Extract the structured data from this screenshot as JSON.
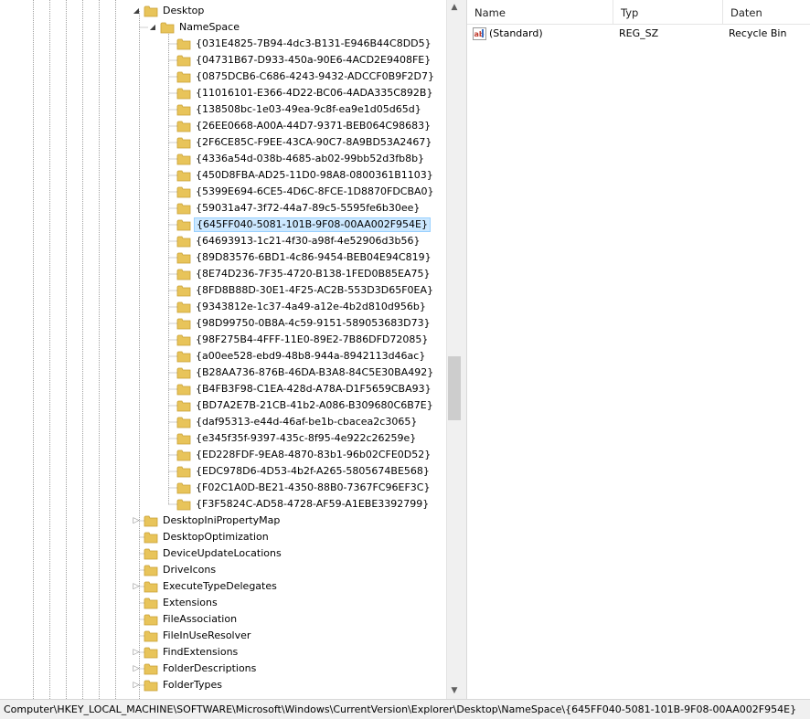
{
  "tree": {
    "expanded_parent": {
      "label": "Desktop"
    },
    "namespace": {
      "label": "NameSpace"
    },
    "namespace_children": [
      {
        "label": "{031E4825-7B94-4dc3-B131-E946B44C8DD5}",
        "selected": false
      },
      {
        "label": "{04731B67-D933-450a-90E6-4ACD2E9408FE}",
        "selected": false
      },
      {
        "label": "{0875DCB6-C686-4243-9432-ADCCF0B9F2D7}",
        "selected": false
      },
      {
        "label": "{11016101-E366-4D22-BC06-4ADA335C892B}",
        "selected": false
      },
      {
        "label": "{138508bc-1e03-49ea-9c8f-ea9e1d05d65d}",
        "selected": false
      },
      {
        "label": "{26EE0668-A00A-44D7-9371-BEB064C98683}",
        "selected": false
      },
      {
        "label": "{2F6CE85C-F9EE-43CA-90C7-8A9BD53A2467}",
        "selected": false
      },
      {
        "label": "{4336a54d-038b-4685-ab02-99bb52d3fb8b}",
        "selected": false
      },
      {
        "label": "{450D8FBA-AD25-11D0-98A8-0800361B1103}",
        "selected": false
      },
      {
        "label": "{5399E694-6CE5-4D6C-8FCE-1D8870FDCBA0}",
        "selected": false
      },
      {
        "label": "{59031a47-3f72-44a7-89c5-5595fe6b30ee}",
        "selected": false
      },
      {
        "label": "{645FF040-5081-101B-9F08-00AA002F954E}",
        "selected": true
      },
      {
        "label": "{64693913-1c21-4f30-a98f-4e52906d3b56}",
        "selected": false
      },
      {
        "label": "{89D83576-6BD1-4c86-9454-BEB04E94C819}",
        "selected": false
      },
      {
        "label": "{8E74D236-7F35-4720-B138-1FED0B85EA75}",
        "selected": false
      },
      {
        "label": "{8FD8B88D-30E1-4F25-AC2B-553D3D65F0EA}",
        "selected": false
      },
      {
        "label": "{9343812e-1c37-4a49-a12e-4b2d810d956b}",
        "selected": false
      },
      {
        "label": "{98D99750-0B8A-4c59-9151-589053683D73}",
        "selected": false
      },
      {
        "label": "{98F275B4-4FFF-11E0-89E2-7B86DFD72085}",
        "selected": false
      },
      {
        "label": "{a00ee528-ebd9-48b8-944a-8942113d46ac}",
        "selected": false
      },
      {
        "label": "{B28AA736-876B-46DA-B3A8-84C5E30BA492}",
        "selected": false
      },
      {
        "label": "{B4FB3F98-C1EA-428d-A78A-D1F5659CBA93}",
        "selected": false
      },
      {
        "label": "{BD7A2E7B-21CB-41b2-A086-B309680C6B7E}",
        "selected": false
      },
      {
        "label": "{daf95313-e44d-46af-be1b-cbacea2c3065}",
        "selected": false
      },
      {
        "label": "{e345f35f-9397-435c-8f95-4e922c26259e}",
        "selected": false
      },
      {
        "label": "{ED228FDF-9EA8-4870-83b1-96b02CFE0D52}",
        "selected": false
      },
      {
        "label": "{EDC978D6-4D53-4b2f-A265-5805674BE568}",
        "selected": false
      },
      {
        "label": "{F02C1A0D-BE21-4350-88B0-7367FC96EF3C}",
        "selected": false
      },
      {
        "label": "{F3F5824C-AD58-4728-AF59-A1EBE3392799}",
        "selected": false
      }
    ],
    "siblings": [
      {
        "label": "DesktopIniPropertyMap",
        "expandable": true
      },
      {
        "label": "DesktopOptimization",
        "expandable": false
      },
      {
        "label": "DeviceUpdateLocations",
        "expandable": false
      },
      {
        "label": "DriveIcons",
        "expandable": false
      },
      {
        "label": "ExecuteTypeDelegates",
        "expandable": true
      },
      {
        "label": "Extensions",
        "expandable": false
      },
      {
        "label": "FileAssociation",
        "expandable": false
      },
      {
        "label": "FileInUseResolver",
        "expandable": false
      },
      {
        "label": "FindExtensions",
        "expandable": true
      },
      {
        "label": "FolderDescriptions",
        "expandable": true
      },
      {
        "label": "FolderTypes",
        "expandable": true
      }
    ]
  },
  "list": {
    "columns": {
      "name": "Name",
      "type": "Typ",
      "data": "Daten"
    },
    "rows": [
      {
        "name": "(Standard)",
        "type": "REG_SZ",
        "data": "Recycle Bin",
        "icon": "string-value-icon"
      }
    ]
  },
  "status_bar": {
    "path": "Computer\\HKEY_LOCAL_MACHINE\\SOFTWARE\\Microsoft\\Windows\\CurrentVersion\\Explorer\\Desktop\\NameSpace\\{645FF040-5081-101B-9F08-00AA002F954E}"
  },
  "colors": {
    "folder": "#e8c45a",
    "folder_dark": "#c9a033",
    "selection_bg": "#cce8ff",
    "selection_border": "#99d1ff"
  }
}
